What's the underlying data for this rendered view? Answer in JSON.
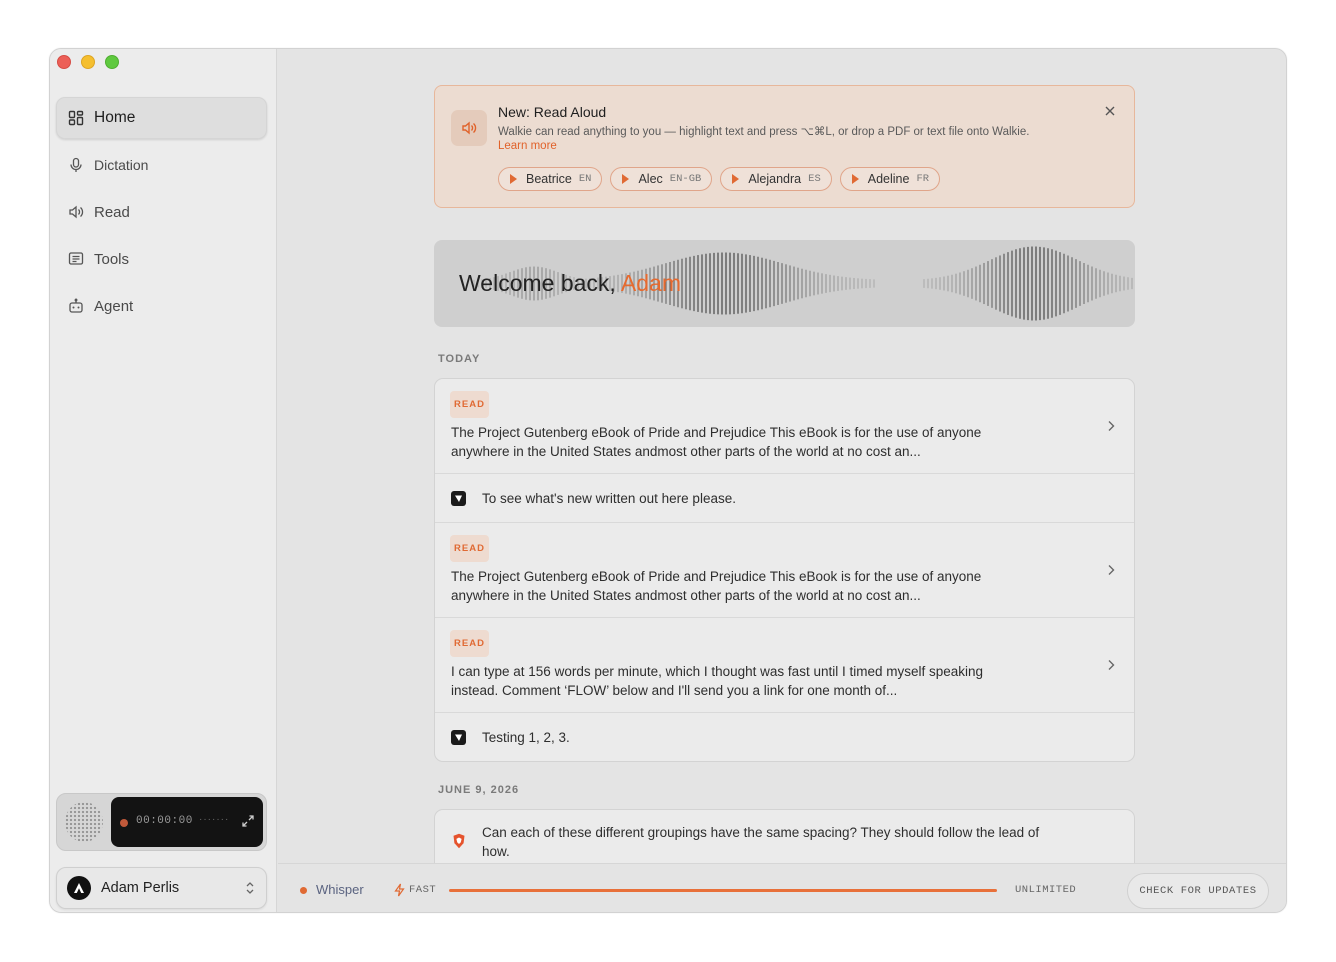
{
  "sidebar": {
    "items": [
      {
        "label": "Home",
        "icon": "grid-icon",
        "active": true
      },
      {
        "label": "Dictation",
        "icon": "microphone-icon"
      },
      {
        "label": "Read",
        "icon": "speaker-icon"
      },
      {
        "label": "Tools",
        "icon": "document-icon"
      },
      {
        "label": "Agent",
        "icon": "robot-icon"
      }
    ],
    "recorder": {
      "time": "00:00:00",
      "dots": "·······"
    },
    "user": {
      "name": "Adam Perlis"
    }
  },
  "banner": {
    "title": "New: Read Aloud",
    "description": "Walkie can read anything to you — highlight text and press ⌥⌘L, or drop a PDF or text file onto Walkie.",
    "link": "Learn more",
    "voices": [
      {
        "name": "Beatrice",
        "lang": "EN"
      },
      {
        "name": "Alec",
        "lang": "EN-GB"
      },
      {
        "name": "Alejandra",
        "lang": "ES"
      },
      {
        "name": "Adeline",
        "lang": "FR"
      }
    ]
  },
  "welcome": {
    "prefix": "Welcome back, ",
    "name": "Adam"
  },
  "sections": {
    "today": "TODAY",
    "june": "JUNE 9, 2026"
  },
  "today_items": [
    {
      "type": "read",
      "badge": "READ",
      "text": "The Project Gutenberg eBook of Pride and Prejudice This eBook is for the use of anyone anywhere in the United States andmost other parts of the world at no cost an..."
    },
    {
      "type": "dictation",
      "text": "To see what's new written out here please."
    },
    {
      "type": "read",
      "badge": "READ",
      "text": "The Project Gutenberg eBook of Pride and Prejudice This eBook is for the use of anyone anywhere in the United States andmost other parts of the world at no cost an..."
    },
    {
      "type": "read",
      "badge": "READ",
      "text": "I can type at 156 words per minute, which I thought was fast until I timed myself speaking instead. Comment ‘FLOW’ below and I'll send you a link for one month of..."
    },
    {
      "type": "dictation",
      "text": "Testing 1, 2, 3."
    }
  ],
  "june_items": [
    {
      "type": "dictation",
      "text": "Can each of these different groupings have the same spacing? They should follow the lead of how."
    }
  ],
  "statusbar": {
    "model": "Whisper",
    "speed": "FAST",
    "usage_fraction": 1.0,
    "plan": "UNLIMITED",
    "update_button": "CHECK FOR UPDATES"
  },
  "colors": {
    "accent": "#e66a2f",
    "sidebar_bg": "#ececec",
    "main_bg": "#e4e4e4"
  }
}
